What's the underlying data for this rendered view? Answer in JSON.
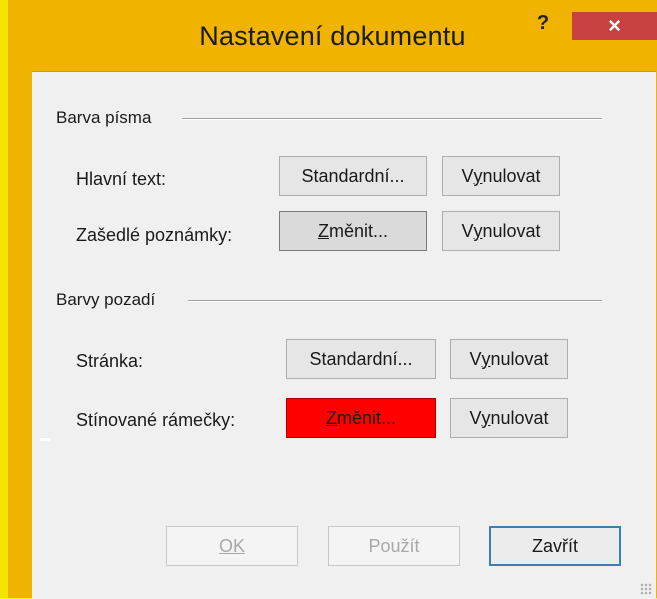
{
  "window": {
    "title": "Nastavení dokumentu",
    "help_label": "?",
    "close_label": "×"
  },
  "font_color_group": {
    "label": "Barva písma",
    "rows": [
      {
        "label": "Hlavní text:",
        "change_button": "Standardní...",
        "reset_button": "Vynulovat",
        "reset_access_key": "y"
      },
      {
        "label": "Zašedlé poznámky:",
        "change_button": "Změnit...",
        "change_access_key": "Z",
        "reset_button": "Vynulovat",
        "reset_access_key": "y"
      }
    ]
  },
  "background_group": {
    "label": "Barvy pozadí",
    "rows": [
      {
        "label": "Stránka:",
        "change_button": "Standardní...",
        "reset_button": "Vynulovat",
        "reset_access_key": "y"
      },
      {
        "label": "Stínované rámečky:",
        "change_button": "Změnit...",
        "change_access_key": "Z",
        "reset_button": "Vynulovat",
        "reset_access_key": "y",
        "swatch_color": "#ff0000"
      }
    ]
  },
  "footer": {
    "ok_label": "OK",
    "apply_label": "Použít",
    "close_label": "Zavřít"
  },
  "colors": {
    "titlebar": "#f0b400",
    "close_button": "#c84040",
    "desktop": "#ffff00",
    "shaded_frames_color": "#ff0000"
  }
}
